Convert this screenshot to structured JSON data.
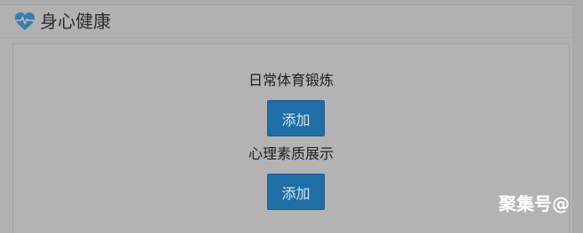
{
  "section": {
    "title": "身心健康",
    "icon": "heart-pulse-icon",
    "icon_color": "#3a7cae"
  },
  "items": [
    {
      "label": "日常体育锻炼",
      "button_label": "添加"
    },
    {
      "label": "心理素质展示",
      "button_label": "添加"
    }
  ],
  "colors": {
    "button": "#1f6ea6",
    "background": "#b1b1b1"
  },
  "watermark": "聚集号@"
}
